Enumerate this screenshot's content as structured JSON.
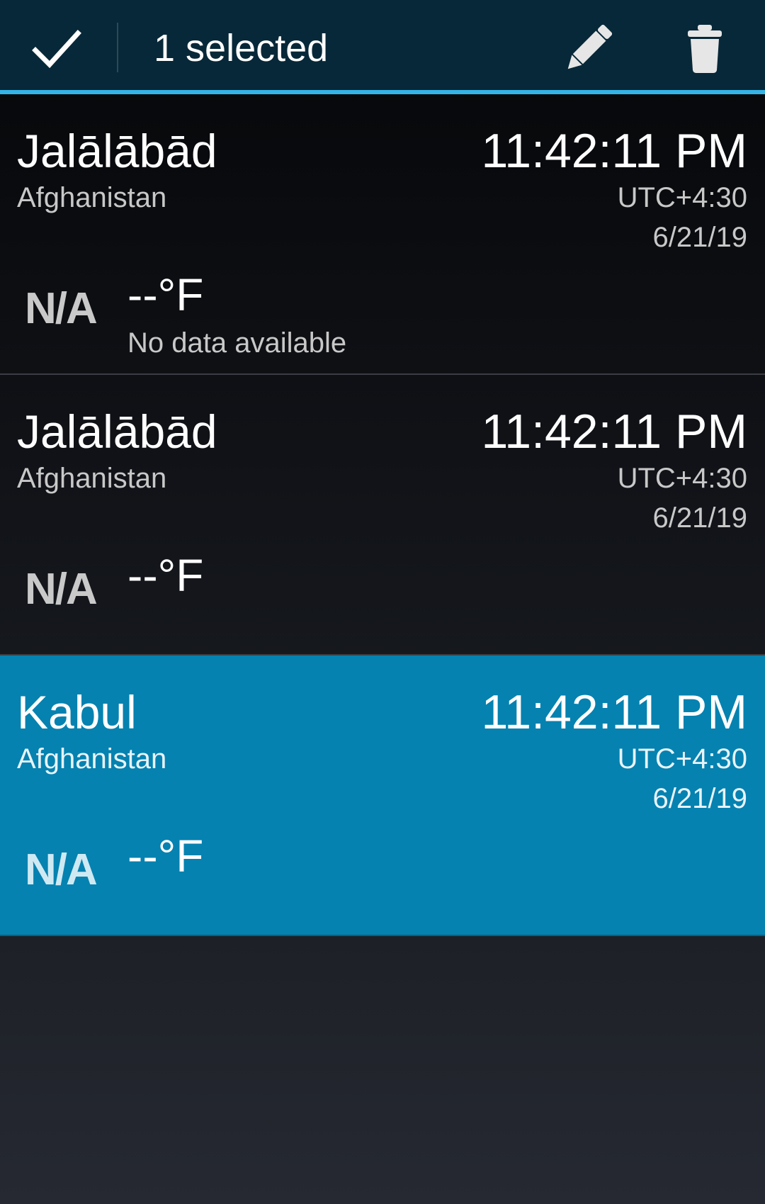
{
  "action_bar": {
    "title": "1 selected",
    "done_icon": "check-icon",
    "edit_icon": "pencil-icon",
    "delete_icon": "trash-icon",
    "accent_color": "#35b3e4"
  },
  "rows": [
    {
      "city": "Jalālābād",
      "country": "Afghanistan",
      "time": "11:42:11 PM",
      "timezone": "UTC+4:30",
      "date": "6/21/19",
      "condition_icon": "N/A",
      "temperature": "--°F",
      "status": "No data available",
      "selected": false
    },
    {
      "city": "Jalālābād",
      "country": "Afghanistan",
      "time": "11:42:11 PM",
      "timezone": "UTC+4:30",
      "date": "6/21/19",
      "condition_icon": "N/A",
      "temperature": "--°F",
      "status": "",
      "selected": false
    },
    {
      "city": "Kabul",
      "country": "Afghanistan",
      "time": "11:42:11 PM",
      "timezone": "UTC+4:30",
      "date": "6/21/19",
      "condition_icon": "N/A",
      "temperature": "--°F",
      "status": "",
      "selected": true
    }
  ],
  "selected_color": "#0582b0"
}
